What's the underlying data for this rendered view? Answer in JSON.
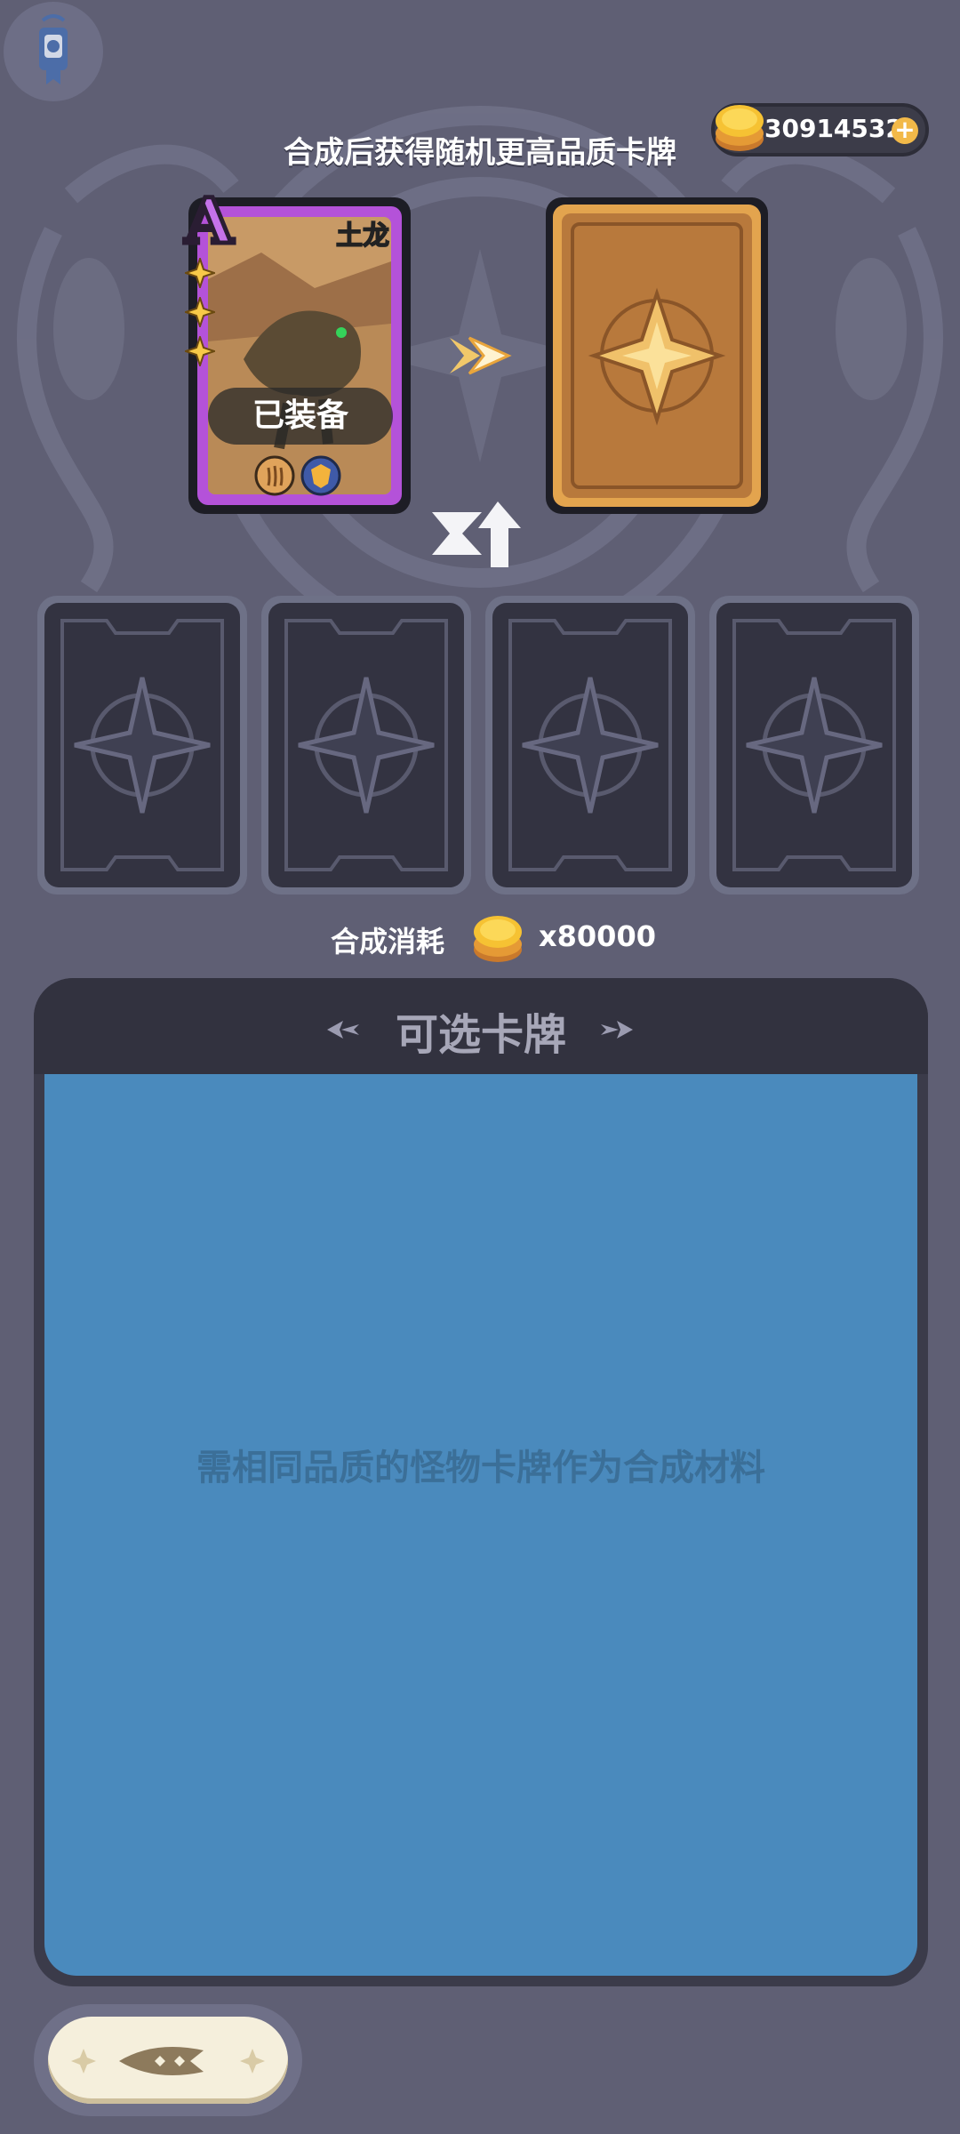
{
  "header": {
    "service_icon": "service-icon",
    "coin_icon": "gold-coin-icon",
    "coin_amount": "30914532",
    "add_icon": "plus-icon",
    "add_label": "+"
  },
  "headline": "合成后获得随机更高品质卡牌",
  "equipped_card": {
    "grade": "A",
    "name": "土龙",
    "stars": 3,
    "badge": "已装备",
    "skill_icons": [
      "claw-skill-icon",
      "shield-skill-icon"
    ]
  },
  "result_card": {
    "icon": "card-back-icon"
  },
  "material_slots": [
    {
      "icon": "empty-slot-icon"
    },
    {
      "icon": "empty-slot-icon"
    },
    {
      "icon": "empty-slot-icon"
    },
    {
      "icon": "empty-slot-icon"
    }
  ],
  "cost": {
    "label": "合成消耗",
    "coin_icon": "gold-coin-icon",
    "value": "x80000"
  },
  "panel": {
    "title": "可选卡牌",
    "empty_hint": "需相同品质的怪物卡牌作为合成材料"
  },
  "bottom_button": {
    "icon": "ornament-icon"
  },
  "colors": {
    "background": "#5f5f74",
    "panel_body": "#4a8abd",
    "panel_header": "#32323f",
    "card_frame_purple": "#b452d9",
    "card_back_gold": "#b8793c",
    "coin": "#f2b949"
  }
}
